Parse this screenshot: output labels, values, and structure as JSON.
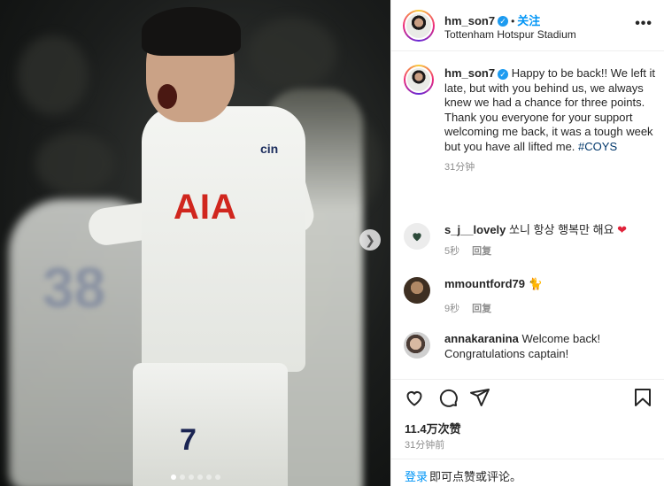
{
  "post": {
    "username": "hm_son7",
    "follow_label": "关注",
    "location": "Tottenham Hotspur Stadium",
    "caption": "Happy to be back!! We left it late, but with you behind us, we always knew we had a chance for three points. Thank you everyone for your support welcoming me back, it was a tough week but you have all lifted me.",
    "hashtag": "#COYS",
    "caption_time": "31分钟",
    "likes": "11.4万次赞",
    "posted_ago": "31分钟前"
  },
  "comments": [
    {
      "username": "s_j__lovely",
      "text": "쏘니 항상 행복만 해요",
      "emoji": "heart",
      "time": "5秒",
      "reply": "回复"
    },
    {
      "username": "mmountford79",
      "text": "",
      "emoji": "cat",
      "time": "9秒",
      "reply": "回复"
    },
    {
      "username": "annakaranina",
      "text": "Welcome back! Congratulations captain!",
      "time": "",
      "reply": ""
    }
  ],
  "media": {
    "sponsor": "AIA",
    "sleeve": "cin",
    "shorts_number": "7",
    "teammate_number": "38",
    "carousel_dots": 6,
    "active_dot": 0
  },
  "login_bar": {
    "link": "登录",
    "rest": "即可点赞或评论。"
  },
  "icons": [
    "more-icon",
    "heart-icon",
    "comment-icon",
    "share-icon",
    "bookmark-icon",
    "next-arrow-icon",
    "verified-icon"
  ],
  "colors": {
    "accent": "#0095f6",
    "verified": "#1d9bf0",
    "heart": "#ed4956",
    "hashtag": "#00376b"
  }
}
